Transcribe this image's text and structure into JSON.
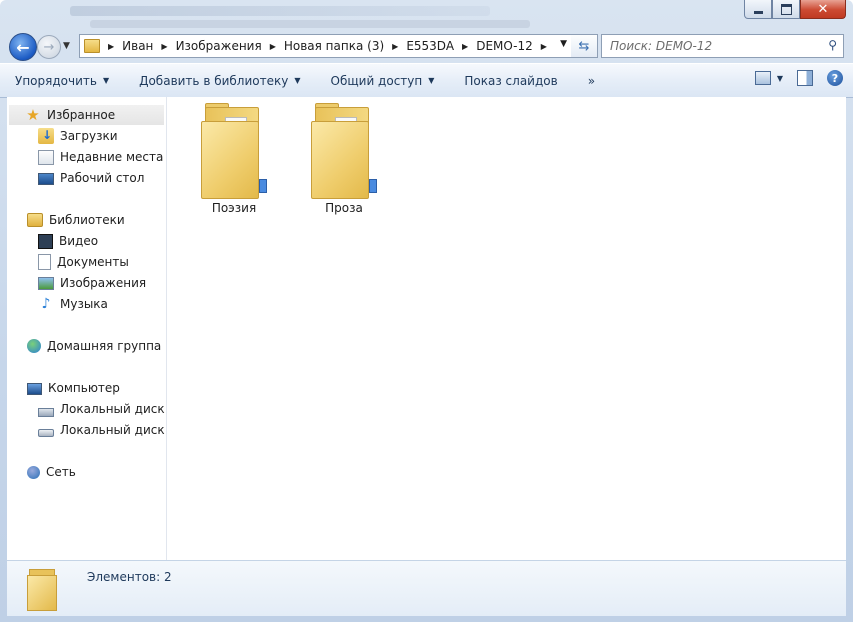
{
  "window": {
    "controls": {
      "minimize": "minimize-icon",
      "maximize": "maximize-icon",
      "close": "✕"
    }
  },
  "nav": {
    "back_glyph": "←",
    "forward_glyph": "→",
    "breadcrumb": [
      "Иван",
      "Изображения",
      "Новая папка (3)",
      "E553DA",
      "DEMO-12"
    ],
    "search_placeholder": "Поиск: DEMO-12"
  },
  "toolbar": {
    "items": [
      {
        "label": "Упорядочить",
        "has_dropdown": true
      },
      {
        "label": "Добавить в библиотеку",
        "has_dropdown": true
      },
      {
        "label": "Общий доступ",
        "has_dropdown": true
      },
      {
        "label": "Показ слайдов",
        "has_dropdown": false
      }
    ],
    "more": "»",
    "help": "?"
  },
  "sidebar": {
    "favorites": {
      "label": "Избранное",
      "items": [
        "Загрузки",
        "Недавние места",
        "Рабочий стол"
      ]
    },
    "libraries": {
      "label": "Библиотеки",
      "items": [
        "Видео",
        "Документы",
        "Изображения",
        "Музыка"
      ]
    },
    "homegroup": {
      "label": "Домашняя группа"
    },
    "computer": {
      "label": "Компьютер",
      "items": [
        "Локальный диск (C",
        "Локальный диск (D"
      ]
    },
    "network": {
      "label": "Сеть"
    }
  },
  "content": {
    "items": [
      {
        "name": "Поэзия",
        "type": "folder"
      },
      {
        "name": "Проза",
        "type": "folder"
      }
    ]
  },
  "status": {
    "text": "Элементов: 2"
  }
}
